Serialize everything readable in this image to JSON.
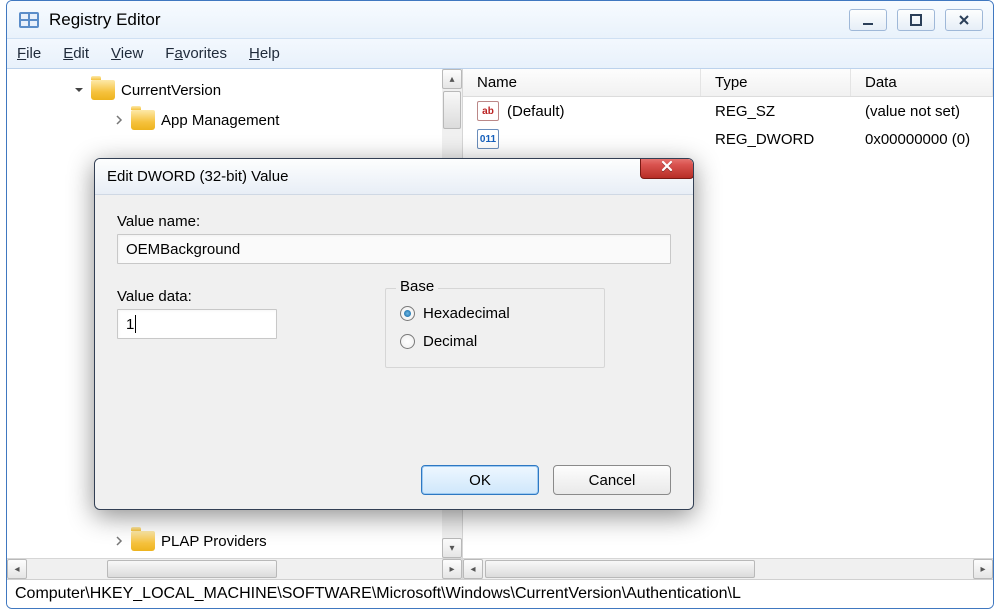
{
  "window": {
    "title": "Registry Editor"
  },
  "menu": {
    "file": "File",
    "edit": "Edit",
    "view": "View",
    "favorites": "Favorites",
    "help": "Help"
  },
  "tree": {
    "nodes": [
      {
        "label": "CurrentVersion",
        "expanded": true
      },
      {
        "label": "App Management",
        "expanded": false
      },
      {
        "label": "PLAP Providers",
        "expanded": false
      }
    ]
  },
  "listview": {
    "headers": {
      "name": "Name",
      "type": "Type",
      "data": "Data"
    },
    "rows": [
      {
        "icon": "ab",
        "name": "(Default)",
        "type": "REG_SZ",
        "data": "(value not set)"
      },
      {
        "icon": "011",
        "name": "",
        "type": "REG_DWORD",
        "data": "0x00000000 (0)"
      }
    ]
  },
  "statusbar": {
    "path": "Computer\\HKEY_LOCAL_MACHINE\\SOFTWARE\\Microsoft\\Windows\\CurrentVersion\\Authentication\\L"
  },
  "dialog": {
    "title": "Edit DWORD (32-bit) Value",
    "value_name_label": "Value name:",
    "value_name": "OEMBackground",
    "value_data_label": "Value data:",
    "value_data": "1",
    "base_label": "Base",
    "hex_label": "Hexadecimal",
    "dec_label": "Decimal",
    "base_selected": "hex",
    "ok": "OK",
    "cancel": "Cancel"
  }
}
